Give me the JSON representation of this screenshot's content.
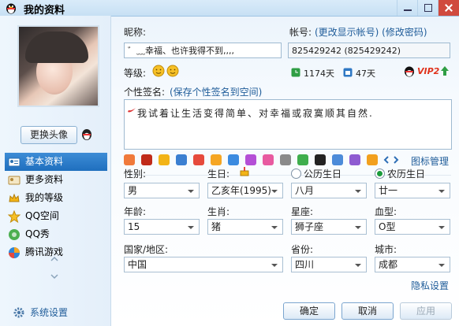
{
  "window": {
    "title": "我的资料"
  },
  "sidebar": {
    "change_avatar": "更换头像",
    "items": [
      {
        "label": "基本资料",
        "active": true
      },
      {
        "label": "更多资料"
      },
      {
        "label": "我的等级"
      },
      {
        "label": "QQ空间"
      },
      {
        "label": "QQ秀"
      },
      {
        "label": "腾讯游戏"
      }
    ],
    "system_settings": "系统设置"
  },
  "profile": {
    "nickname_label": "昵称:",
    "nickname_value": "゛﹏幸福、也许我得不到,,,,",
    "account_label": "帐号:",
    "account_links": "(更改显示帐号) (修改密码)",
    "account_value": "825429242 (825429242)",
    "level_label": "等级:",
    "days_online": "1174天",
    "days_active": "47天",
    "vip_label": "VIP2",
    "signature_label": "个性签名:",
    "signature_link": "(保存个性签名到空间)",
    "signature_text": "我试着让生活变得简单、对幸福或寂寞顺其自然.",
    "icon_manage": "图标管理",
    "gender_label": "性别:",
    "gender_value": "男",
    "birthday_label": "生日:",
    "calendar_solar": "公历生日",
    "calendar_lunar": "农历生日",
    "birth_year": "乙亥年(1995)",
    "birth_month": "八月",
    "birth_day": "廿一",
    "age_label": "年龄:",
    "age_value": "15",
    "zodiac_label": "生肖:",
    "zodiac_value": "猪",
    "constellation_label": "星座:",
    "constellation_value": "狮子座",
    "blood_label": "血型:",
    "blood_value": "O型",
    "country_label": "国家/地区:",
    "country_value": "中国",
    "province_label": "省份:",
    "province_value": "四川",
    "city_label": "城市:",
    "city_value": "成都",
    "privacy_link": "隐私设置"
  },
  "buttons": {
    "ok": "确定",
    "cancel": "取消",
    "apply": "应用"
  }
}
